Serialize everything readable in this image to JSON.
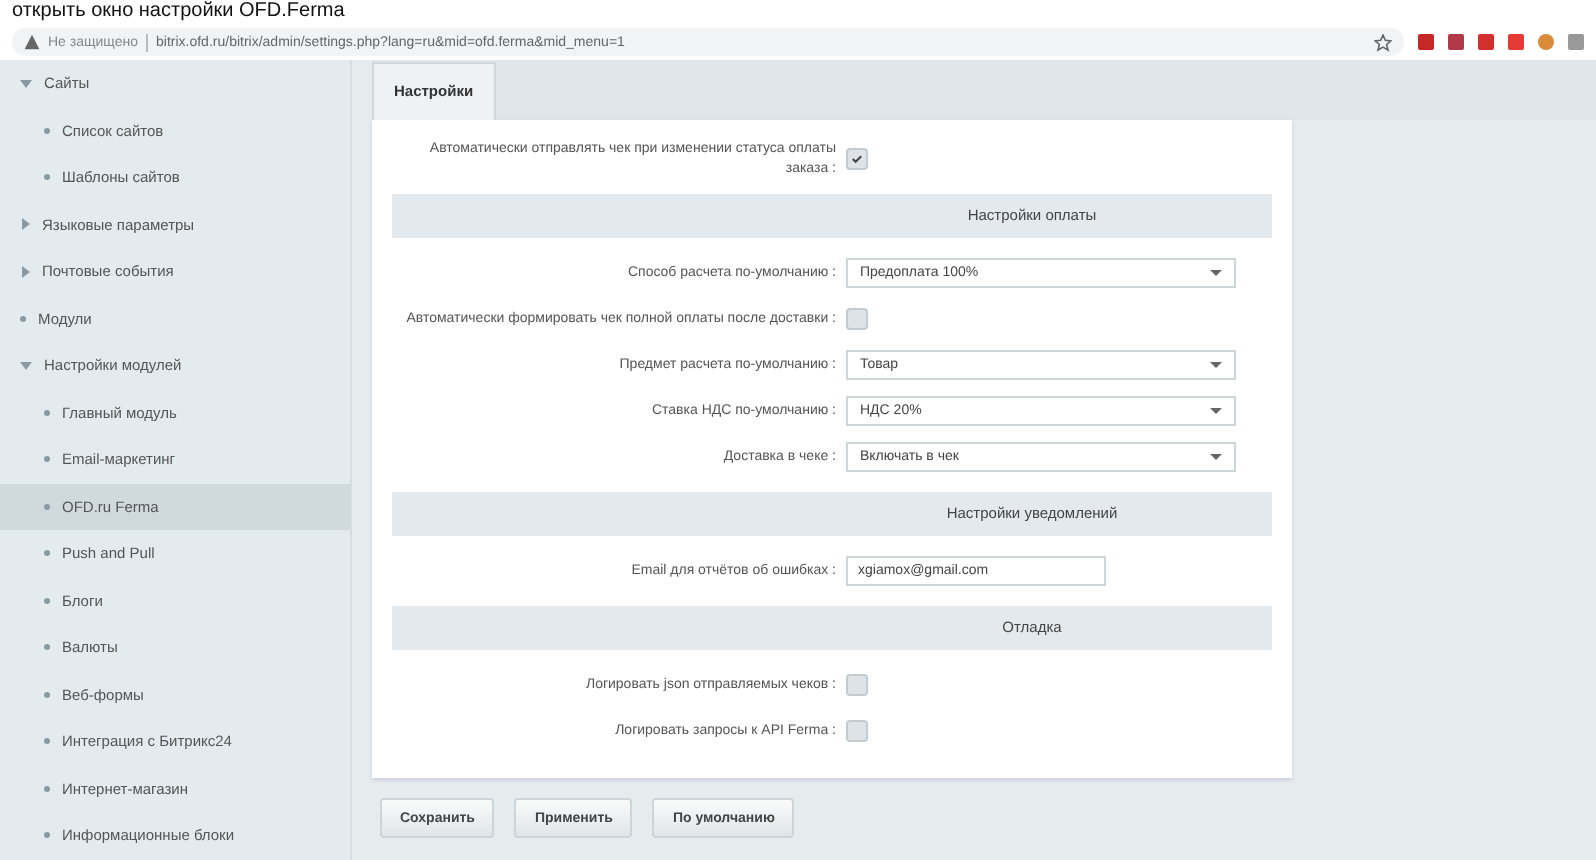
{
  "caption": "открыть окно настройки OFD.Ferma",
  "browser": {
    "security": "Не защищено",
    "url": "bitrix.ofd.ru/bitrix/admin/settings.php?lang=ru&mid=ofd.ferma&mid_menu=1"
  },
  "sidebar": {
    "items": [
      {
        "label": "Сайты",
        "kind": "folder",
        "expanded": true,
        "selected": false,
        "children": [
          {
            "label": "Список сайтов",
            "kind": "leaf",
            "selected": false
          },
          {
            "label": "Шаблоны сайтов",
            "kind": "leaf",
            "selected": false
          }
        ]
      },
      {
        "label": "Языковые параметры",
        "kind": "folder",
        "expanded": false,
        "selected": false
      },
      {
        "label": "Почтовые события",
        "kind": "folder",
        "expanded": false,
        "selected": false
      },
      {
        "label": "Модули",
        "kind": "leaf",
        "selected": false
      },
      {
        "label": "Настройки модулей",
        "kind": "folder",
        "expanded": true,
        "selected": false,
        "children": [
          {
            "label": "Главный модуль",
            "kind": "leaf",
            "selected": false
          },
          {
            "label": "Email-маркетинг",
            "kind": "leaf",
            "selected": false
          },
          {
            "label": "OFD.ru Ferma",
            "kind": "leaf",
            "selected": true
          },
          {
            "label": "Push and Pull",
            "kind": "leaf",
            "selected": false
          },
          {
            "label": "Блоги",
            "kind": "leaf",
            "selected": false
          },
          {
            "label": "Валюты",
            "kind": "leaf",
            "selected": false
          },
          {
            "label": "Веб-формы",
            "kind": "leaf",
            "selected": false
          },
          {
            "label": "Интеграция с Битрикс24",
            "kind": "leaf",
            "selected": false
          },
          {
            "label": "Интернет-магазин",
            "kind": "leaf",
            "selected": false
          },
          {
            "label": "Информационные блоки",
            "kind": "leaf",
            "selected": false
          }
        ]
      }
    ]
  },
  "tabs": [
    {
      "label": "Настройки",
      "selected": true
    }
  ],
  "form": [
    {
      "kind": "checkbox",
      "label": "Автоматически отправлять чек при изменении статуса оплаты заказа :",
      "checked": true
    },
    {
      "kind": "section",
      "label": "Настройки оплаты"
    },
    {
      "kind": "select",
      "label": "Способ расчета по-умолчанию :",
      "value": "Предоплата 100%"
    },
    {
      "kind": "checkbox",
      "label": "Автоматически формировать чек полной оплаты после доставки :",
      "checked": false
    },
    {
      "kind": "select",
      "label": "Предмет расчета по-умолчанию :",
      "value": "Товар"
    },
    {
      "kind": "select",
      "label": "Ставка НДС по-умолчанию :",
      "value": "НДС 20%"
    },
    {
      "kind": "select",
      "label": "Доставка в чеке :",
      "value": "Включать в чек"
    },
    {
      "kind": "section",
      "label": "Настройки уведомлений"
    },
    {
      "kind": "input",
      "label": "Email для отчётов об ошибках :",
      "value": "xgiamox@gmail.com"
    },
    {
      "kind": "section",
      "label": "Отладка"
    },
    {
      "kind": "checkbox",
      "label": "Логировать json отправляемых чеков :",
      "checked": false
    },
    {
      "kind": "checkbox",
      "label": "Логировать запросы к API Ferma :",
      "checked": false
    }
  ],
  "buttons": [
    "Сохранить",
    "Применить",
    "По умолчанию"
  ]
}
